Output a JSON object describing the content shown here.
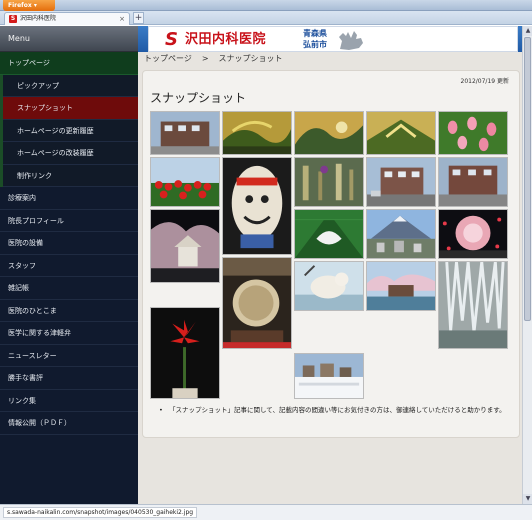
{
  "browser": {
    "menu_label": "Firefox ▾",
    "tab_favicon": "S",
    "tab_title": "沢田内科医院",
    "tab_close": "×",
    "new_tab": "+"
  },
  "sidebar": {
    "menu_label": "Menu",
    "items": [
      {
        "label": "トップページ"
      },
      {
        "label": "ピックアップ"
      },
      {
        "label": "スナップショット"
      },
      {
        "label": "ホームページの更新履歴"
      },
      {
        "label": "ホームページの改装履歴"
      },
      {
        "label": "制作リンク"
      },
      {
        "label": "診療案内"
      },
      {
        "label": "院長プロフィール"
      },
      {
        "label": "医院の設備"
      },
      {
        "label": "スタッフ"
      },
      {
        "label": "雑記帳"
      },
      {
        "label": "医院のひとこま"
      },
      {
        "label": "医学に関する津軽弁"
      },
      {
        "label": "ニュースレター"
      },
      {
        "label": "勝手な書評"
      },
      {
        "label": "リンク集"
      },
      {
        "label": "情報公開（ＰＤＦ）"
      }
    ]
  },
  "banner": {
    "logo_mark": "S",
    "logo_text": "沢田内科医院",
    "prefecture": "青森県",
    "city": "弘前市",
    "map_icon": "aomori-map-icon"
  },
  "breadcrumb": {
    "home": "トップページ",
    "separator": ">",
    "current": "スナップショット"
  },
  "content": {
    "updated": "2012/07/19 更新",
    "title": "スナップショット",
    "note_bullet": "•",
    "note": "「スナップショット」記事に関して、記載内容の間違い等にお気付きの方は、御連絡していただけると助かります。"
  },
  "scrollbar": {
    "up": "▲",
    "down": "▼",
    "position": 0.0
  },
  "status": {
    "url": "s.sawada-naikalin.com/snapshot/images/040530_gaiheki2.jpg"
  }
}
